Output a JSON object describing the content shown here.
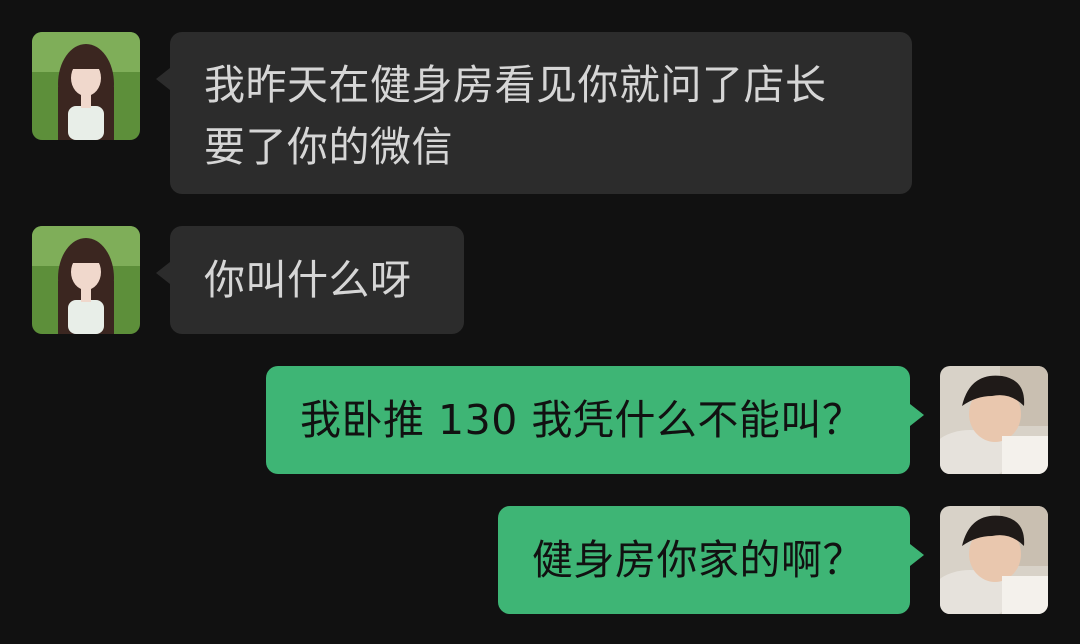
{
  "conversation": {
    "messages": [
      {
        "side": "incoming",
        "sender": "girl",
        "lines": [
          "我昨天在健身房看见你就问了店长",
          "要了你的微信"
        ]
      },
      {
        "side": "incoming",
        "sender": "girl",
        "lines": [
          "你叫什么呀"
        ]
      },
      {
        "side": "outgoing",
        "sender": "me",
        "lines": [
          "我卧推 130 我凭什么不能叫？"
        ]
      },
      {
        "side": "outgoing",
        "sender": "me",
        "lines": [
          "健身房你家的啊？"
        ]
      }
    ]
  },
  "theme": {
    "background": "#111111",
    "incoming_bubble": "#2c2c2c",
    "incoming_text": "#d6d6d6",
    "outgoing_bubble": "#3eb575",
    "outgoing_text": "#111111"
  },
  "avatars": {
    "girl": "girl-photo-avatar",
    "me": "boy-photo-avatar"
  }
}
